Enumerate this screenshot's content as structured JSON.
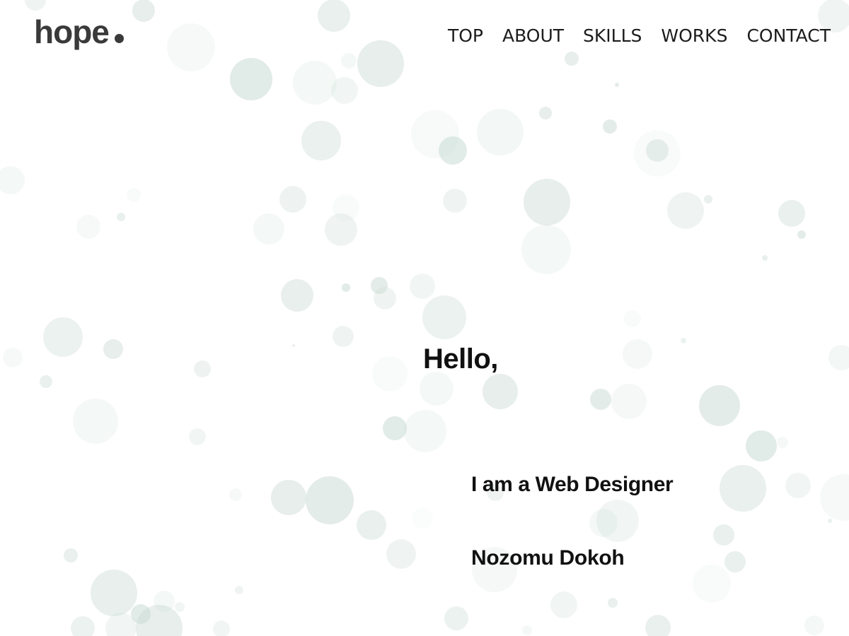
{
  "site": {
    "logo_text": "hope"
  },
  "nav": {
    "items": [
      {
        "label": "TOP"
      },
      {
        "label": "ABOUT"
      },
      {
        "label": "SKILLS"
      },
      {
        "label": "WORKS"
      },
      {
        "label": "CONTACT"
      }
    ]
  },
  "hero": {
    "greeting": "Hello,",
    "role": "I am a Web Designer",
    "name": "Nozomu Dokoh"
  },
  "colors": {
    "background": "#ffffff",
    "bubble": "#c9dad3",
    "logo": "#3a3a3a",
    "text": "#111111"
  }
}
